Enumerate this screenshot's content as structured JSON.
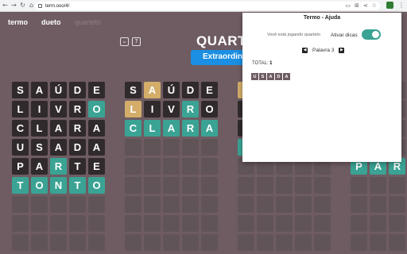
{
  "browser": {
    "nav": [
      "←",
      "→",
      "↻",
      "⌂"
    ],
    "url": "term.ooo/4/",
    "colors": {
      "secure_icon": "#5f6368"
    }
  },
  "header": {
    "tabs": [
      {
        "label": "termo",
        "active": true
      },
      {
        "label": "dueto",
        "active": true
      },
      {
        "label": "quarteto",
        "active": false
      }
    ],
    "icon_buttons": {
      "stats": "⌄",
      "help": "?"
    },
    "title": "QUARTE",
    "difficulty_label": "Extraordin"
  },
  "boards": [
    {
      "rows": [
        [
          {
            "l": "S",
            "s": "absent"
          },
          {
            "l": "A",
            "s": "absent"
          },
          {
            "l": "Ú",
            "s": "absent"
          },
          {
            "l": "D",
            "s": "absent"
          },
          {
            "l": "E",
            "s": "absent"
          }
        ],
        [
          {
            "l": "L",
            "s": "absent"
          },
          {
            "l": "I",
            "s": "absent"
          },
          {
            "l": "V",
            "s": "absent"
          },
          {
            "l": "R",
            "s": "absent"
          },
          {
            "l": "O",
            "s": "correct"
          }
        ],
        [
          {
            "l": "C",
            "s": "absent"
          },
          {
            "l": "L",
            "s": "absent"
          },
          {
            "l": "A",
            "s": "absent"
          },
          {
            "l": "R",
            "s": "absent"
          },
          {
            "l": "A",
            "s": "absent"
          }
        ],
        [
          {
            "l": "U",
            "s": "absent"
          },
          {
            "l": "S",
            "s": "absent"
          },
          {
            "l": "A",
            "s": "absent"
          },
          {
            "l": "D",
            "s": "absent"
          },
          {
            "l": "A",
            "s": "absent"
          }
        ],
        [
          {
            "l": "P",
            "s": "absent"
          },
          {
            "l": "A",
            "s": "absent"
          },
          {
            "l": "R",
            "s": "correct"
          },
          {
            "l": "T",
            "s": "absent"
          },
          {
            "l": "E",
            "s": "absent"
          }
        ],
        [
          {
            "l": "T",
            "s": "correct"
          },
          {
            "l": "O",
            "s": "correct"
          },
          {
            "l": "N",
            "s": "correct"
          },
          {
            "l": "T",
            "s": "correct"
          },
          {
            "l": "O",
            "s": "correct"
          }
        ],
        [
          {
            "l": "",
            "s": "empty"
          },
          {
            "l": "",
            "s": "empty"
          },
          {
            "l": "",
            "s": "empty"
          },
          {
            "l": "",
            "s": "empty"
          },
          {
            "l": "",
            "s": "empty"
          }
        ],
        [
          {
            "l": "",
            "s": "empty"
          },
          {
            "l": "",
            "s": "empty"
          },
          {
            "l": "",
            "s": "empty"
          },
          {
            "l": "",
            "s": "empty"
          },
          {
            "l": "",
            "s": "empty"
          }
        ],
        [
          {
            "l": "",
            "s": "empty"
          },
          {
            "l": "",
            "s": "empty"
          },
          {
            "l": "",
            "s": "empty"
          },
          {
            "l": "",
            "s": "empty"
          },
          {
            "l": "",
            "s": "empty"
          }
        ]
      ]
    },
    {
      "rows": [
        [
          {
            "l": "S",
            "s": "absent"
          },
          {
            "l": "A",
            "s": "present"
          },
          {
            "l": "Ú",
            "s": "absent"
          },
          {
            "l": "D",
            "s": "absent"
          },
          {
            "l": "E",
            "s": "absent"
          }
        ],
        [
          {
            "l": "L",
            "s": "present"
          },
          {
            "l": "I",
            "s": "absent"
          },
          {
            "l": "V",
            "s": "absent"
          },
          {
            "l": "R",
            "s": "correct"
          },
          {
            "l": "O",
            "s": "absent"
          }
        ],
        [
          {
            "l": "C",
            "s": "correct"
          },
          {
            "l": "L",
            "s": "correct"
          },
          {
            "l": "A",
            "s": "correct"
          },
          {
            "l": "R",
            "s": "correct"
          },
          {
            "l": "A",
            "s": "correct"
          }
        ],
        [
          {
            "l": "",
            "s": "empty"
          },
          {
            "l": "",
            "s": "empty"
          },
          {
            "l": "",
            "s": "empty"
          },
          {
            "l": "",
            "s": "empty"
          },
          {
            "l": "",
            "s": "empty"
          }
        ],
        [
          {
            "l": "",
            "s": "empty"
          },
          {
            "l": "",
            "s": "empty"
          },
          {
            "l": "",
            "s": "empty"
          },
          {
            "l": "",
            "s": "empty"
          },
          {
            "l": "",
            "s": "empty"
          }
        ],
        [
          {
            "l": "",
            "s": "empty"
          },
          {
            "l": "",
            "s": "empty"
          },
          {
            "l": "",
            "s": "empty"
          },
          {
            "l": "",
            "s": "empty"
          },
          {
            "l": "",
            "s": "empty"
          }
        ],
        [
          {
            "l": "",
            "s": "empty"
          },
          {
            "l": "",
            "s": "empty"
          },
          {
            "l": "",
            "s": "empty"
          },
          {
            "l": "",
            "s": "empty"
          },
          {
            "l": "",
            "s": "empty"
          }
        ],
        [
          {
            "l": "",
            "s": "empty"
          },
          {
            "l": "",
            "s": "empty"
          },
          {
            "l": "",
            "s": "empty"
          },
          {
            "l": "",
            "s": "empty"
          },
          {
            "l": "",
            "s": "empty"
          }
        ],
        [
          {
            "l": "",
            "s": "empty"
          },
          {
            "l": "",
            "s": "empty"
          },
          {
            "l": "",
            "s": "empty"
          },
          {
            "l": "",
            "s": "empty"
          },
          {
            "l": "",
            "s": "empty"
          }
        ]
      ]
    },
    {
      "rows": [
        [
          {
            "l": "",
            "s": "present"
          },
          {
            "l": "",
            "s": "empty"
          },
          {
            "l": "",
            "s": "empty"
          },
          {
            "l": "",
            "s": "empty"
          },
          {
            "l": "",
            "s": "empty"
          }
        ],
        [
          {
            "l": "",
            "s": "absent"
          },
          {
            "l": "",
            "s": "empty"
          },
          {
            "l": "",
            "s": "empty"
          },
          {
            "l": "",
            "s": "empty"
          },
          {
            "l": "",
            "s": "empty"
          }
        ],
        [
          {
            "l": "",
            "s": "absent"
          },
          {
            "l": "",
            "s": "empty"
          },
          {
            "l": "",
            "s": "empty"
          },
          {
            "l": "",
            "s": "empty"
          },
          {
            "l": "",
            "s": "empty"
          }
        ],
        [
          {
            "l": "",
            "s": "correct"
          },
          {
            "l": "",
            "s": "empty"
          },
          {
            "l": "",
            "s": "empty"
          },
          {
            "l": "",
            "s": "empty"
          },
          {
            "l": "",
            "s": "empty"
          }
        ],
        [
          {
            "l": "",
            "s": "empty"
          },
          {
            "l": "",
            "s": "empty"
          },
          {
            "l": "",
            "s": "empty"
          },
          {
            "l": "",
            "s": "empty"
          },
          {
            "l": "",
            "s": "empty"
          }
        ],
        [
          {
            "l": "",
            "s": "empty"
          },
          {
            "l": "",
            "s": "empty"
          },
          {
            "l": "",
            "s": "empty"
          },
          {
            "l": "",
            "s": "empty"
          },
          {
            "l": "",
            "s": "empty"
          }
        ],
        [
          {
            "l": "",
            "s": "empty"
          },
          {
            "l": "",
            "s": "empty"
          },
          {
            "l": "",
            "s": "empty"
          },
          {
            "l": "",
            "s": "empty"
          },
          {
            "l": "",
            "s": "empty"
          }
        ],
        [
          {
            "l": "",
            "s": "empty"
          },
          {
            "l": "",
            "s": "empty"
          },
          {
            "l": "",
            "s": "empty"
          },
          {
            "l": "",
            "s": "empty"
          },
          {
            "l": "",
            "s": "empty"
          }
        ],
        [
          {
            "l": "",
            "s": "empty"
          },
          {
            "l": "",
            "s": "empty"
          },
          {
            "l": "",
            "s": "empty"
          },
          {
            "l": "",
            "s": "empty"
          },
          {
            "l": "",
            "s": "empty"
          }
        ]
      ]
    },
    {
      "rows": [
        [
          {
            "l": "",
            "s": "empty"
          },
          {
            "l": "",
            "s": "empty"
          },
          {
            "l": "",
            "s": "empty"
          }
        ],
        [
          {
            "l": "",
            "s": "empty"
          },
          {
            "l": "",
            "s": "empty"
          },
          {
            "l": "",
            "s": "empty"
          }
        ],
        [
          {
            "l": "",
            "s": "empty"
          },
          {
            "l": "",
            "s": "empty"
          },
          {
            "l": "",
            "s": "empty"
          }
        ],
        [
          {
            "l": "",
            "s": "empty"
          },
          {
            "l": "",
            "s": "empty"
          },
          {
            "l": "",
            "s": "empty"
          }
        ],
        [
          {
            "l": "P",
            "s": "correct"
          },
          {
            "l": "A",
            "s": "correct"
          },
          {
            "l": "R",
            "s": "correct"
          }
        ],
        [
          {
            "l": "",
            "s": "empty"
          },
          {
            "l": "",
            "s": "empty"
          },
          {
            "l": "",
            "s": "empty"
          }
        ],
        [
          {
            "l": "",
            "s": "empty"
          },
          {
            "l": "",
            "s": "empty"
          },
          {
            "l": "",
            "s": "empty"
          }
        ],
        [
          {
            "l": "",
            "s": "empty"
          },
          {
            "l": "",
            "s": "empty"
          },
          {
            "l": "",
            "s": "empty"
          }
        ],
        [
          {
            "l": "",
            "s": "empty"
          },
          {
            "l": "",
            "s": "empty"
          },
          {
            "l": "",
            "s": "empty"
          }
        ]
      ]
    }
  ],
  "help_popup": {
    "title": "Termo - Ajuda",
    "playing_text": "Você está jogando quarteto",
    "hints_label": "Ativar dicas",
    "hints_enabled": true,
    "word_label": "Palavra 3",
    "total_label": "TOTAL:",
    "total_value": "1",
    "history_word": [
      "U",
      "S",
      "A",
      "D",
      "A"
    ],
    "arrows": {
      "prev": "◀",
      "next": "▶"
    }
  },
  "colors": {
    "background": "#6e5c62",
    "absent": "#312a2c",
    "present": "#d3ad69",
    "correct": "#3aa394",
    "accent_blue": "#1a8fe3"
  }
}
